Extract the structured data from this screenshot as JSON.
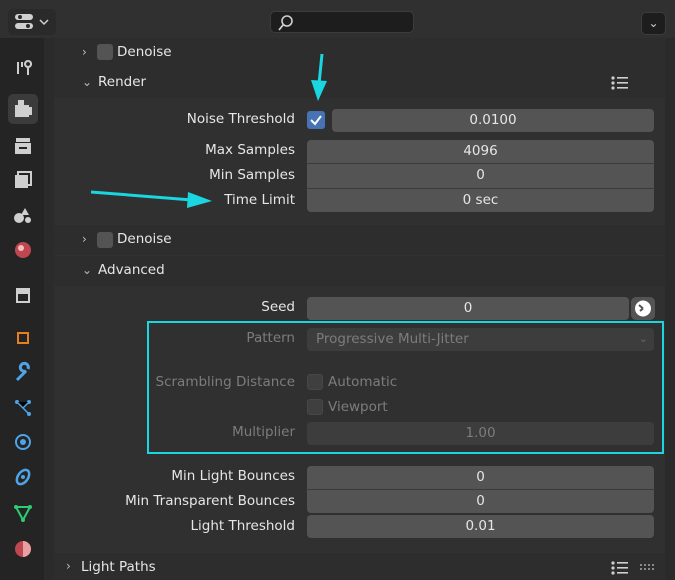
{
  "header": {
    "editor_icon": "properties-editor-icon",
    "search_placeholder": "",
    "collapse_glyph": "⌄"
  },
  "tabs": [
    {
      "icon": "tool-icon"
    },
    {
      "icon": "render-icon",
      "active": true
    },
    {
      "icon": "output-icon"
    },
    {
      "icon": "view-layer-icon"
    },
    {
      "icon": "scene-icon"
    },
    {
      "icon": "world-icon"
    },
    {
      "icon": "collection-icon"
    },
    {
      "icon": "object-icon"
    },
    {
      "icon": "modifier-icon"
    },
    {
      "icon": "particles-icon"
    },
    {
      "icon": "physics-icon"
    },
    {
      "icon": "constraints-icon"
    },
    {
      "icon": "data-icon"
    },
    {
      "icon": "material-icon"
    }
  ],
  "sections": {
    "denoise_top": "Denoise",
    "render": "Render",
    "denoise_mid": "Denoise",
    "advanced": "Advanced",
    "light_paths": "Light Paths"
  },
  "render": {
    "noise_threshold_label": "Noise Threshold",
    "noise_threshold_checked": true,
    "noise_threshold_value": "0.0100",
    "max_samples_label": "Max Samples",
    "max_samples_value": "4096",
    "min_samples_label": "Min Samples",
    "min_samples_value": "0",
    "time_limit_label": "Time Limit",
    "time_limit_value": "0 sec"
  },
  "advanced": {
    "seed_label": "Seed",
    "seed_value": "0",
    "pattern_label": "Pattern",
    "pattern_value": "Progressive Multi-Jitter",
    "scrambling_label": "Scrambling Distance",
    "automatic_label": "Automatic",
    "viewport_label": "Viewport",
    "multiplier_label": "Multiplier",
    "multiplier_value": "1.00",
    "min_light_bounces_label": "Min Light Bounces",
    "min_light_bounces_value": "0",
    "min_transparent_bounces_label": "Min Transparent Bounces",
    "min_transparent_bounces_value": "0",
    "light_threshold_label": "Light Threshold",
    "light_threshold_value": "0.01"
  },
  "colors": {
    "accent": "#4772b3",
    "annotation": "#19d6e0"
  }
}
